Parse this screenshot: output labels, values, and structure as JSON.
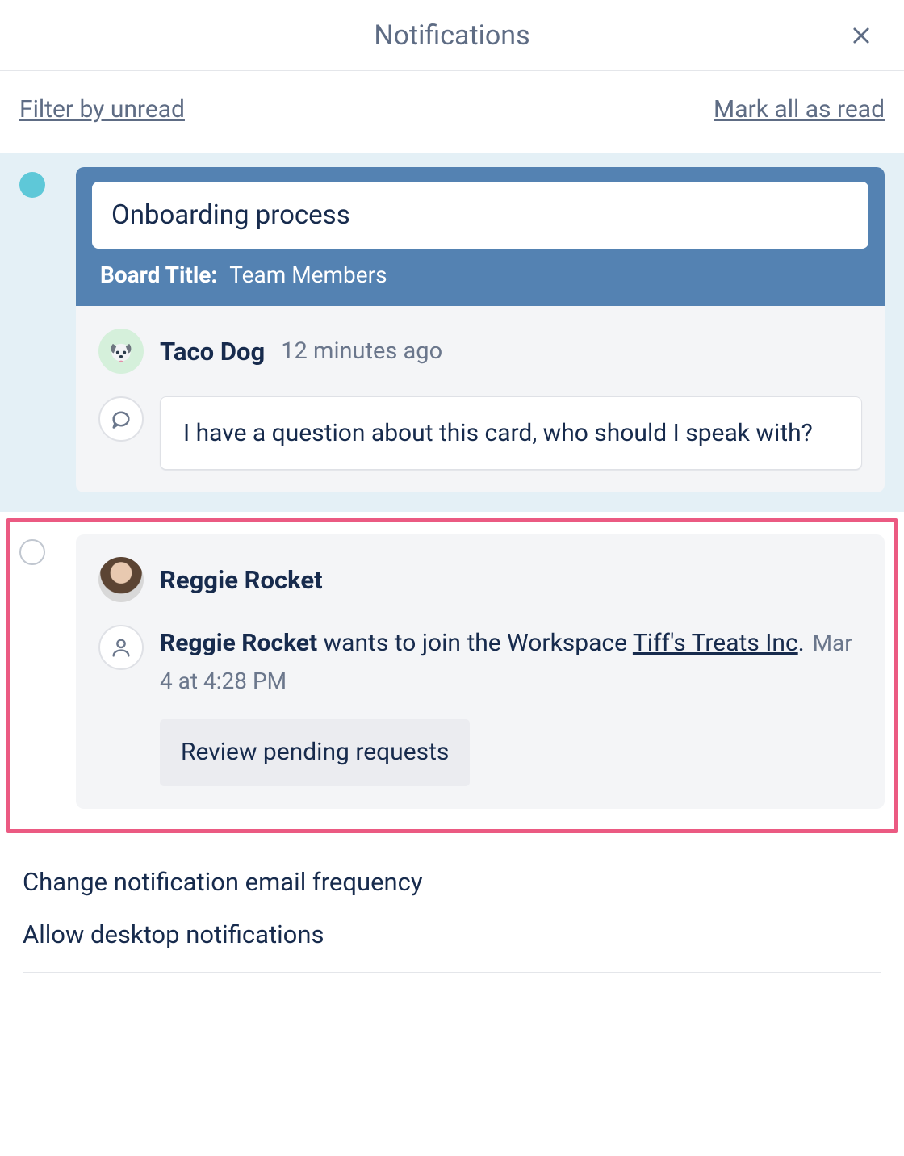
{
  "header": {
    "title": "Notifications",
    "close_icon": "close"
  },
  "toolbar": {
    "filter_label": "Filter by unread",
    "mark_all_label": "Mark all as read"
  },
  "notifications": [
    {
      "unread": true,
      "card_title": "Onboarding process",
      "board_label": "Board Title:",
      "board_value": "Team Members",
      "author_name": "Taco Dog",
      "author_avatar": "taco",
      "timestamp": "12 minutes ago",
      "comment_icon": "speech",
      "comment_text": "I have a question about this card, who should I speak with?"
    },
    {
      "unread": false,
      "author_name": "Reggie Rocket",
      "author_avatar": "photo",
      "request_person": "Reggie Rocket",
      "request_middle": " wants to join the Workspace ",
      "request_workspace": "Tiff's Treats Inc",
      "request_period": ".",
      "request_ts": "Mar 4 at 4:28 PM",
      "person_icon": "person",
      "review_label": "Review pending requests",
      "highlighted": true
    }
  ],
  "footer": {
    "change_freq": "Change notification email frequency",
    "allow_desktop": "Allow desktop notifications"
  }
}
